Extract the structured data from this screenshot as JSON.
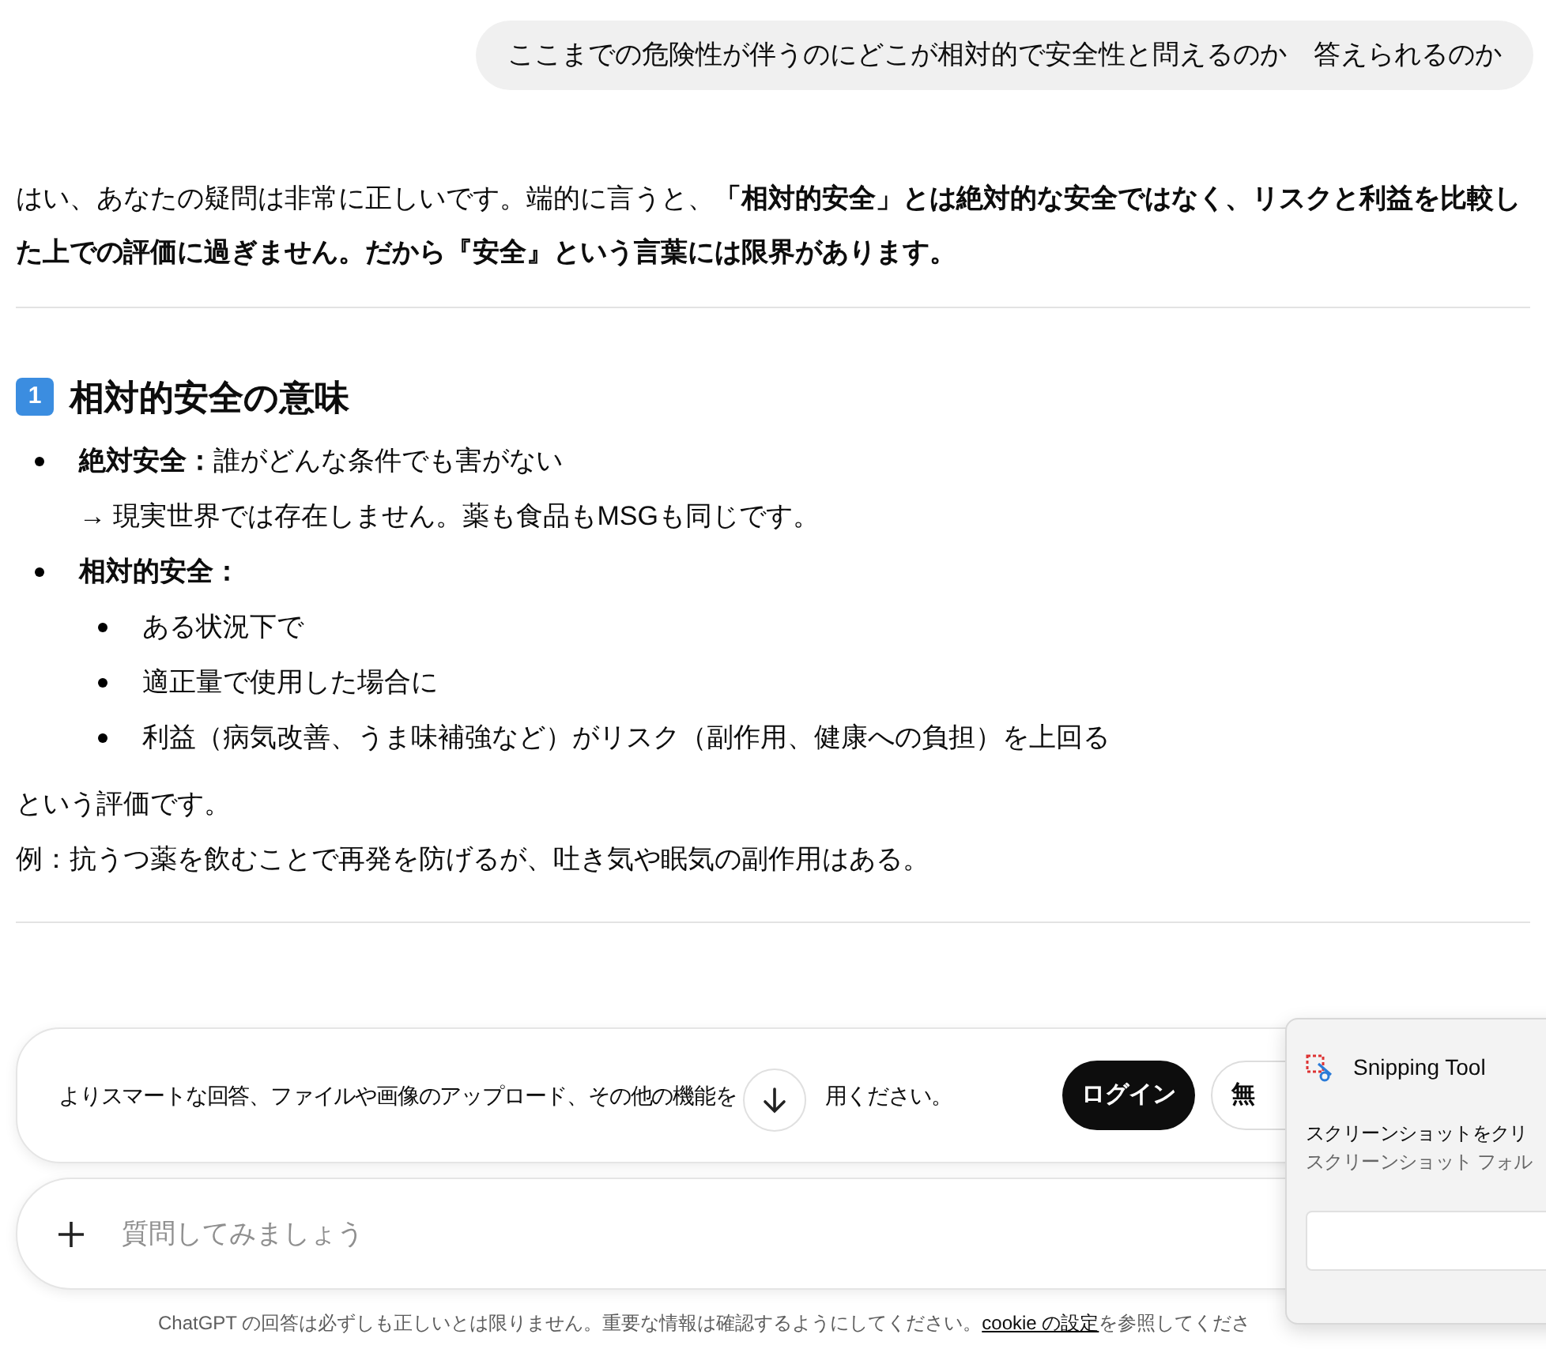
{
  "user_message": "ここまでの危険性が伴うのにどこが相対的で安全性と問えるのか　答えられるのか",
  "answer": {
    "intro": "はい、あなたの疑問は非常に正しいです。端的に言うと、**「相対的安全」とは絶対的な安全ではなく、リスクと利益を比較した上での評価に過ぎません。だから『安全』という言葉には限界があります。**",
    "section": {
      "number": "1",
      "title": "相対的安全の意味",
      "items": [
        {
          "label": "絶対安全：",
          "text": "誰がどんな条件でも害がない",
          "note": "→ 現実世界では存在しません。薬も食品もMSGも同じです。"
        },
        {
          "label": "相対的安全：",
          "children": [
            "ある状況下で",
            "適正量で使用した場合に",
            "利益（病気改善、うま味補強など）がリスク（副作用、健康への負担）を上回る"
          ]
        }
      ],
      "after": [
        "という評価です。",
        "例：抗うつ薬を飲むことで再発を防げるが、吐き気や眠気の副作用はある。"
      ]
    }
  },
  "banner": {
    "text_before": "よりスマートな回答、ファイルや画像のアップロード、その他の機能を",
    "text_after": "用ください。",
    "login": "ログイン",
    "second_button": "無"
  },
  "composer": {
    "placeholder": "質問してみましょう"
  },
  "footer": {
    "text": "ChatGPT の回答は必ずしも正しいとは限りません。重要な情報は確認するようにしてください。",
    "link": "cookie の設定",
    "text_after": "を参照してくださ"
  },
  "notification": {
    "app": "Snipping Tool",
    "title": "スクリーンショットをクリ",
    "body": "スクリーンショット フォル"
  }
}
